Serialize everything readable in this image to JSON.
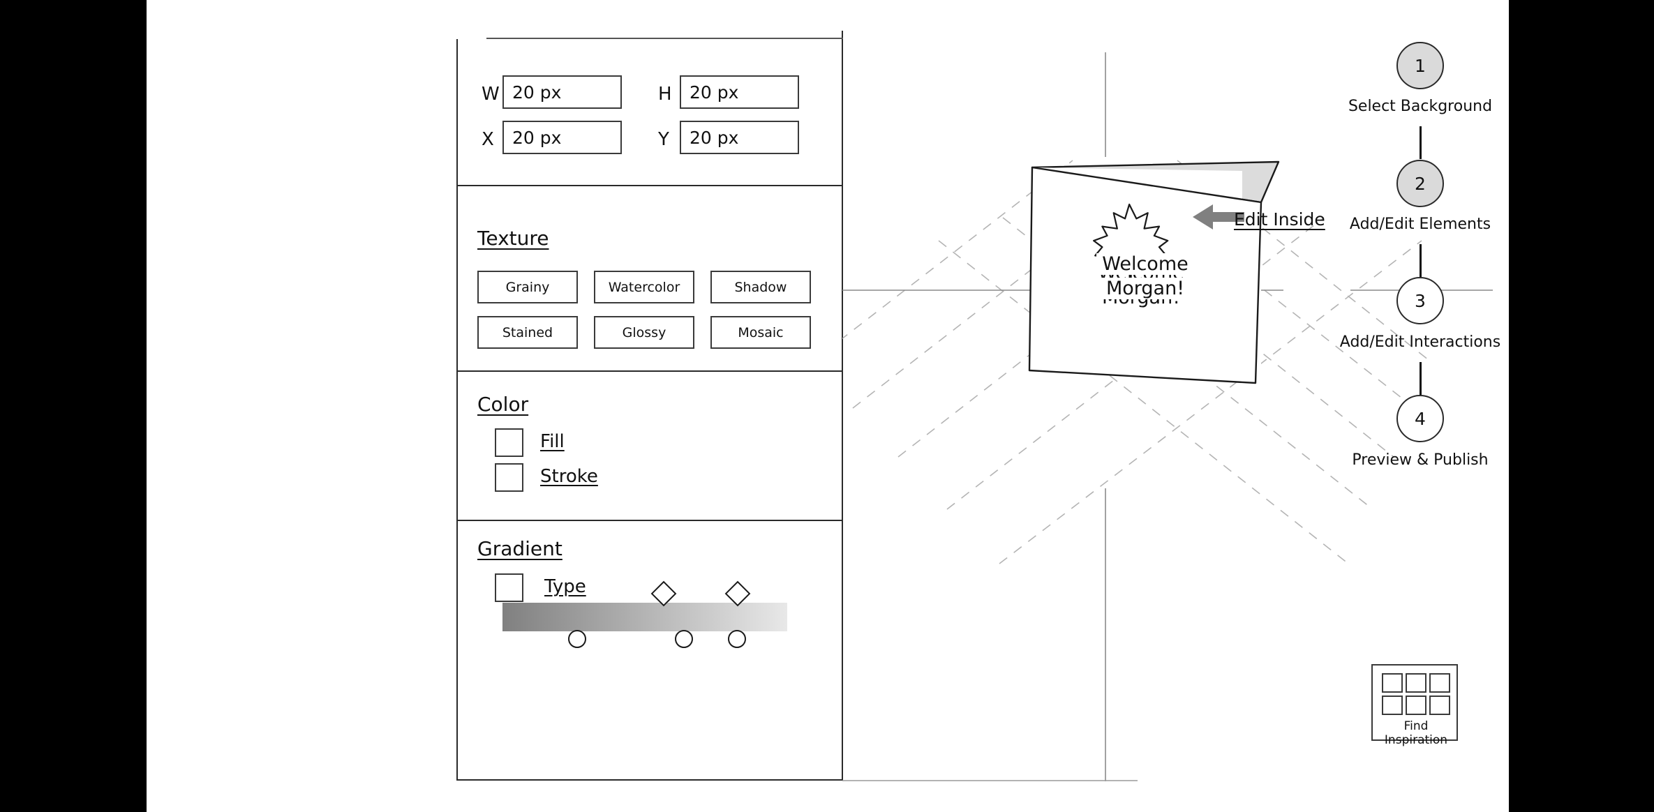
{
  "panel": {
    "dimensions": {
      "fields": [
        {
          "label": "W",
          "value": "20 px"
        },
        {
          "label": "H",
          "value": "20 px"
        },
        {
          "label": "X",
          "value": "20 px"
        },
        {
          "label": "Y",
          "value": "20 px"
        }
      ]
    },
    "texture": {
      "title": "Texture",
      "options": [
        "Grainy",
        "Watercolor",
        "Shadow",
        "Stained",
        "Glossy",
        "Mosaic"
      ]
    },
    "color": {
      "title": "Color",
      "rows": [
        {
          "label": "Fill",
          "swatch": "#ffffff"
        },
        {
          "label": "Stroke",
          "swatch": "#ffffff"
        }
      ]
    },
    "gradient": {
      "title": "Gradient",
      "type_label": "Type",
      "type_swatch": "#ffffff",
      "bar_start_color": "#808080",
      "bar_end_color": "#e8e8e8",
      "diamond_stops": [
        38,
        64
      ],
      "circle_stops": [
        18,
        43,
        55
      ]
    }
  },
  "canvas": {
    "card": {
      "motif": "maple-leaf",
      "line1": "Welcome",
      "line2": "Morgan!",
      "fold_fill": "#dcdcdc"
    },
    "annotation": {
      "label": "Edit Inside",
      "arrow": "left-arrow",
      "arrow_color": "#808080"
    }
  },
  "stepper": {
    "steps": [
      {
        "num": "1",
        "label": "Select Background",
        "state": "done"
      },
      {
        "num": "2",
        "label": "Add/Edit Elements",
        "state": "done"
      },
      {
        "num": "3",
        "label": "Add/Edit Interactions",
        "state": "todo"
      },
      {
        "num": "4",
        "label": "Preview & Publish",
        "state": "todo"
      }
    ]
  },
  "inspiration": {
    "label": "Find Inspiration",
    "cells": 6
  }
}
